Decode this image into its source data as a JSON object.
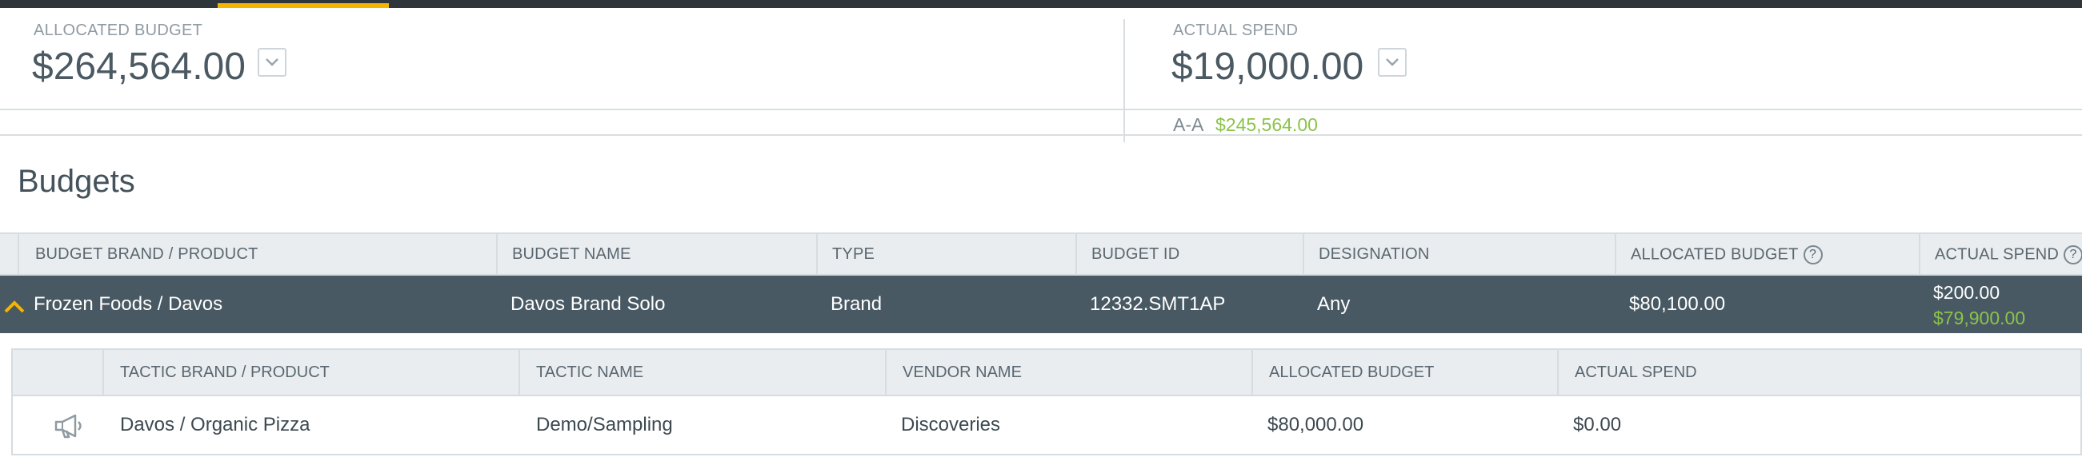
{
  "summary": {
    "allocated_label": "ALLOCATED BUDGET",
    "allocated_value": "$264,564.00",
    "actual_label": "ACTUAL SPEND",
    "actual_value": "$19,000.00",
    "aa_label": "A-A",
    "aa_value": "$245,564.00"
  },
  "section": {
    "title": "Budgets"
  },
  "budget_table": {
    "headers": [
      "BUDGET BRAND / PRODUCT",
      "BUDGET NAME",
      "TYPE",
      "BUDGET ID",
      "DESIGNATION",
      "ALLOCATED BUDGET",
      "ACTUAL SPEND"
    ],
    "row": {
      "brand_product": "Frozen Foods / Davos",
      "budget_name": "Davos Brand Solo",
      "type": "Brand",
      "budget_id": "12332.SMT1AP",
      "designation": "Any",
      "allocated": "$80,100.00",
      "actual_spend": "$200.00",
      "remaining": "$79,900.00"
    }
  },
  "tactic_table": {
    "headers": [
      "TACTIC BRAND / PRODUCT",
      "TACTIC NAME",
      "VENDOR NAME",
      "ALLOCATED BUDGET",
      "ACTUAL SPEND"
    ],
    "row": {
      "brand_product": "Davos / Organic Pizza",
      "tactic_name": "Demo/Sampling",
      "vendor": "Discoveries",
      "allocated": "$80,000.00",
      "actual_spend": "$0.00"
    }
  },
  "colors": {
    "accent": "#f4b400",
    "positive": "#8bc34a",
    "row_dark": "#485963",
    "header_bg": "#e9edf0"
  },
  "icons": [
    "chevron-down-icon",
    "help-icon",
    "chevron-up-icon",
    "megaphone-icon"
  ]
}
